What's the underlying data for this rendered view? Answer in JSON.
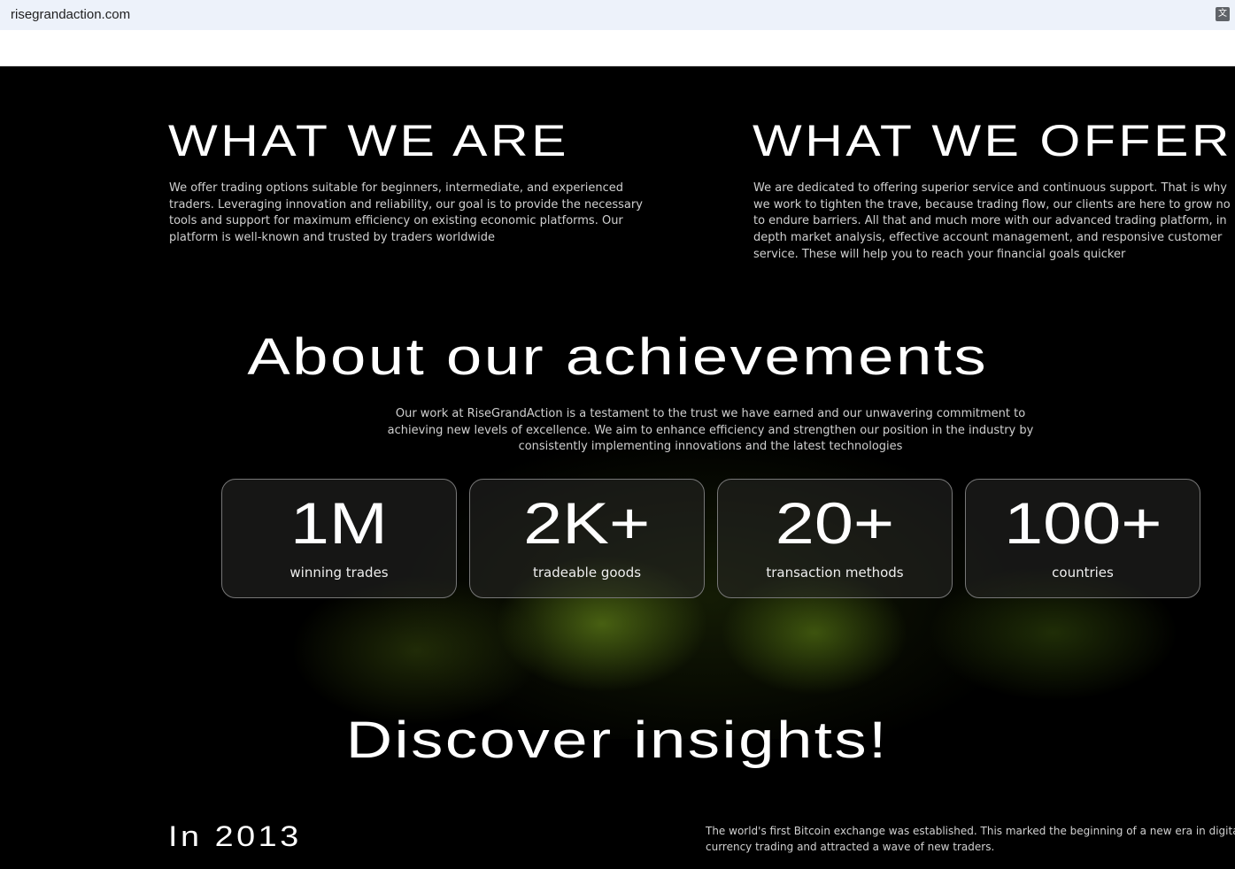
{
  "browser": {
    "url": "risegrandaction.com",
    "translate_icon": "translate-icon"
  },
  "what_we_are": {
    "title": "WHAT WE ARE",
    "lines": [
      "We offer trading options suitable for beginners, intermediate, and experienced",
      "traders. Leveraging innovation and reliability, our goal is to provide the necessary",
      "tools and support for maximum efficiency on existing economic platforms. Our",
      "platform is well-known and trusted by traders worldwide"
    ]
  },
  "what_we_offer": {
    "title": "WHAT WE OFFER",
    "lines": [
      "We are dedicated to offering superior service and continuous support. That is why",
      "we work to tighten the trave, because trading flow, our clients are here to grow no",
      "to endure barriers. All that and much more with our advanced trading platform, in",
      "depth market analysis, effective account management, and responsive customer",
      "service. These will help you to reach your financial goals quicker"
    ]
  },
  "achievements": {
    "title": "About our achievements",
    "lines": [
      "Our work at RiseGrandAction is a testament to the trust we have earned and our unwavering commitment to",
      "achieving new levels of excellence. We aim to enhance efficiency and strengthen our position in the industry by",
      "consistently implementing innovations and the latest technologies"
    ],
    "stats": [
      {
        "value": "1M",
        "label": "winning trades"
      },
      {
        "value": "2K+",
        "label": "tradeable goods"
      },
      {
        "value": "20+",
        "label": "transaction methods"
      },
      {
        "value": "100+",
        "label": "countries"
      }
    ]
  },
  "insights": {
    "title": "Discover insights!",
    "year": "In 2013",
    "lines": [
      "The world's first Bitcoin exchange was established. This marked the beginning of a new era in digital",
      "currency trading and attracted a wave of new traders."
    ]
  }
}
